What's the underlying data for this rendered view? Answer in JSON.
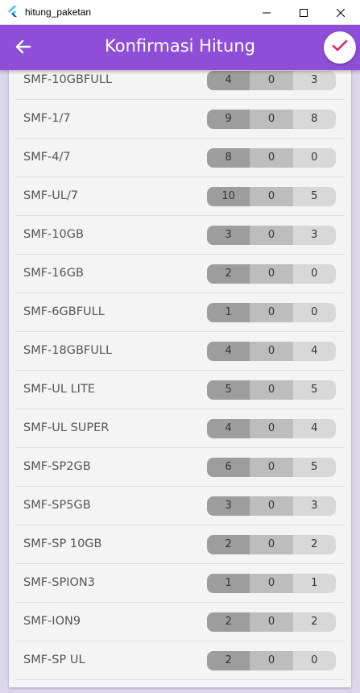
{
  "window": {
    "title": "hitung_paketan",
    "icon": "flutter-icon"
  },
  "appbar": {
    "title": "Konfirmasi Hitung",
    "back_icon": "arrow-back-icon",
    "confirm_icon": "check-icon",
    "color": "#8e4ed8",
    "confirm_color": "#e0245e"
  },
  "rows": [
    {
      "name": "SMF-10GBFULL",
      "a": "4",
      "b": "0",
      "c": "3"
    },
    {
      "name": "SMF-1/7",
      "a": "9",
      "b": "0",
      "c": "8"
    },
    {
      "name": "SMF-4/7",
      "a": "8",
      "b": "0",
      "c": "0"
    },
    {
      "name": "SMF-UL/7",
      "a": "10",
      "b": "0",
      "c": "5"
    },
    {
      "name": "SMF-10GB",
      "a": "3",
      "b": "0",
      "c": "3"
    },
    {
      "name": "SMF-16GB",
      "a": "2",
      "b": "0",
      "c": "0"
    },
    {
      "name": "SMF-6GBFULL",
      "a": "1",
      "b": "0",
      "c": "0"
    },
    {
      "name": "SMF-18GBFULL",
      "a": "4",
      "b": "0",
      "c": "4"
    },
    {
      "name": "SMF-UL LITE",
      "a": "5",
      "b": "0",
      "c": "5"
    },
    {
      "name": "SMF-UL SUPER",
      "a": "4",
      "b": "0",
      "c": "4"
    },
    {
      "name": "SMF-SP2GB",
      "a": "6",
      "b": "0",
      "c": "5"
    },
    {
      "name": "SMF-SP5GB",
      "a": "3",
      "b": "0",
      "c": "3"
    },
    {
      "name": "SMF-SP 10GB",
      "a": "2",
      "b": "0",
      "c": "2"
    },
    {
      "name": "SMF-SPION3",
      "a": "1",
      "b": "0",
      "c": "1"
    },
    {
      "name": "SMF-ION9",
      "a": "2",
      "b": "0",
      "c": "2"
    },
    {
      "name": "SMF-SP UL",
      "a": "2",
      "b": "0",
      "c": "0"
    }
  ]
}
